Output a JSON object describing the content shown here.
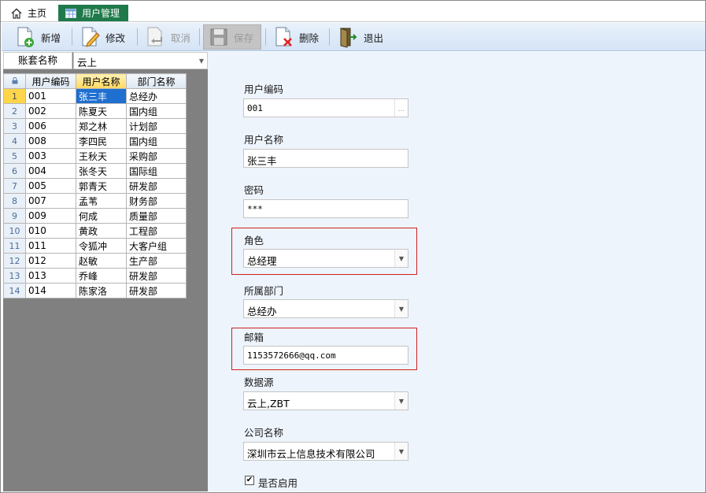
{
  "tabs": [
    {
      "label": "主页",
      "icon": "home-icon"
    },
    {
      "label": "用户管理",
      "icon": "table-icon",
      "active": true
    }
  ],
  "toolbar": {
    "add": "新增",
    "edit": "修改",
    "cancel": "取消",
    "save": "保存",
    "delete": "删除",
    "exit": "退出"
  },
  "account": {
    "label": "账套名称",
    "value": "云上"
  },
  "grid": {
    "columns": [
      "用户编码",
      "用户名称",
      "部门名称"
    ],
    "rows": [
      {
        "no": "1",
        "code": "001",
        "name": "张三丰",
        "dept": "总经办"
      },
      {
        "no": "2",
        "code": "002",
        "name": "陈夏天",
        "dept": "国内组"
      },
      {
        "no": "3",
        "code": "006",
        "name": "郑之林",
        "dept": "计划部"
      },
      {
        "no": "4",
        "code": "008",
        "name": "李四民",
        "dept": "国内组"
      },
      {
        "no": "5",
        "code": "003",
        "name": "王秋天",
        "dept": "采购部"
      },
      {
        "no": "6",
        "code": "004",
        "name": "张冬天",
        "dept": "国际组"
      },
      {
        "no": "7",
        "code": "005",
        "name": "郭青天",
        "dept": "研发部"
      },
      {
        "no": "8",
        "code": "007",
        "name": "孟苇",
        "dept": "财务部"
      },
      {
        "no": "9",
        "code": "009",
        "name": "何成",
        "dept": "质量部"
      },
      {
        "no": "10",
        "code": "010",
        "name": "黄政",
        "dept": "工程部"
      },
      {
        "no": "11",
        "code": "011",
        "name": "令狐冲",
        "dept": "大客户组"
      },
      {
        "no": "12",
        "code": "012",
        "name": "赵敏",
        "dept": "生产部"
      },
      {
        "no": "13",
        "code": "013",
        "name": "乔峰",
        "dept": "研发部"
      },
      {
        "no": "14",
        "code": "014",
        "name": "陈家洛",
        "dept": "研发部"
      }
    ]
  },
  "form": {
    "code_label": "用户编码",
    "code_value": "001",
    "name_label": "用户名称",
    "name_value": "张三丰",
    "password_label": "密码",
    "password_value": "***",
    "role_label": "角色",
    "role_value": "总经理",
    "dept_label": "所属部门",
    "dept_value": "总经办",
    "email_label": "邮箱",
    "email_value": "1153572666@qq.com",
    "datasource_label": "数据源",
    "datasource_value": "云上,ZBT",
    "company_label": "公司名称",
    "company_value": "深圳市云上信息技术有限公司",
    "enabled_label": "是否启用",
    "enabled": true
  },
  "colors": {
    "active_tab": "#1e7a4a",
    "selected_cell": "#1e6fd0",
    "highlight_border": "#d02020",
    "toolbar_bg": "#dbe7f6",
    "form_bg": "#eef4fc"
  }
}
